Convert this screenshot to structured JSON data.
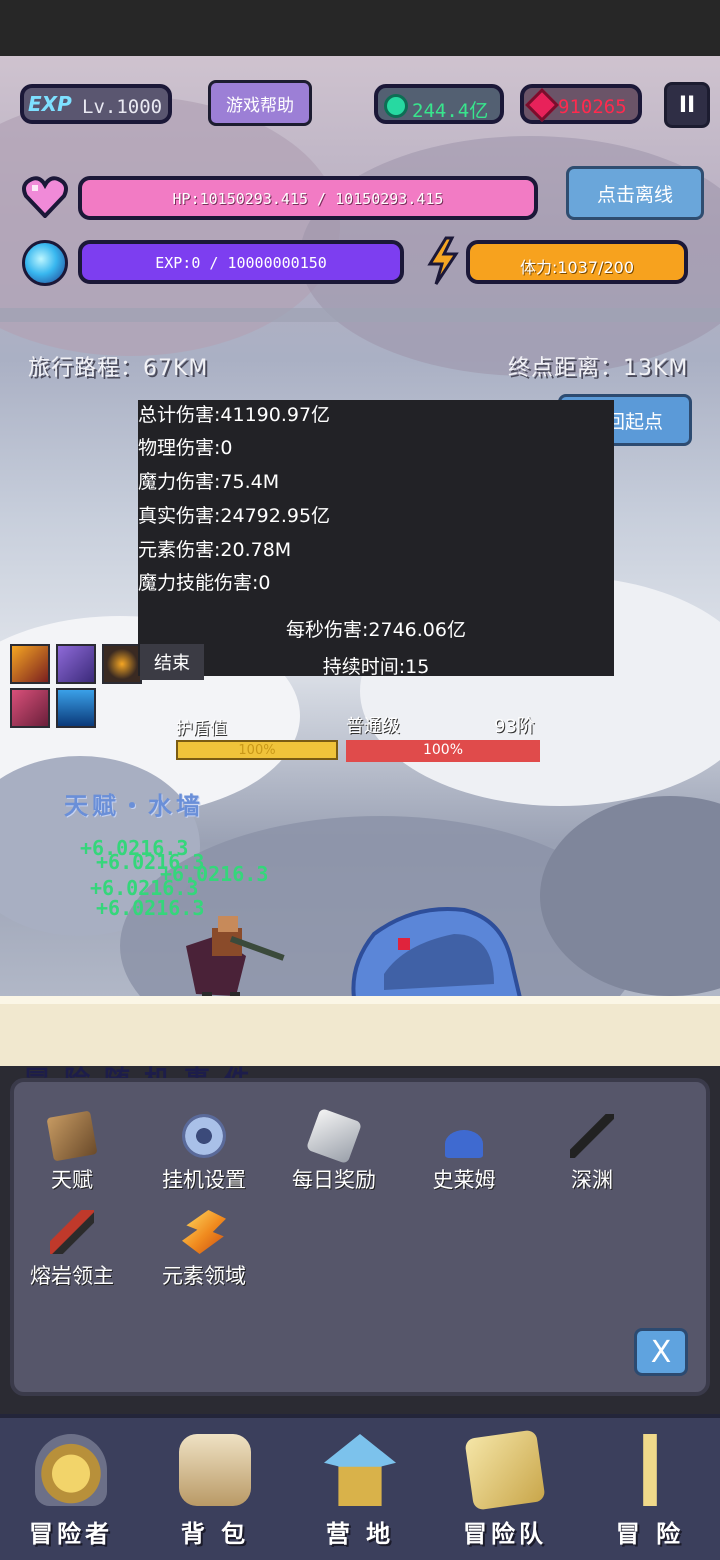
{
  "header": {
    "exp_tag": "EXP",
    "level": "Lv.1000",
    "help_label": "游戏帮助",
    "coins": "244.4亿",
    "gems": "910265",
    "pause_label": "II",
    "offline_label": "点击离线"
  },
  "stats": {
    "hp_text": "HP:10150293.415 / 10150293.415",
    "exp_text": "EXP:0 / 10000000150",
    "stamina_text": "体力:1037/200"
  },
  "journey": {
    "travel": "旅行路程：67KM",
    "remaining": "终点距离：13KM",
    "return_label": "回起点"
  },
  "damage_panel": {
    "total": "总计伤害:41190.97亿",
    "physical": "物理伤害:0",
    "magic": "魔力伤害:75.4M",
    "true_dmg": "真实伤害:24792.95亿",
    "element": "元素伤害:20.78M",
    "magic_skill": "魔力技能伤害:0",
    "dps": "每秒伤害:2746.06亿",
    "duration": "持续时间:15",
    "end_label": "结束"
  },
  "battle": {
    "shield_label": "护盾值",
    "shield_pct": "100%",
    "rank_label": "普通级",
    "tier_label": "93阶",
    "boss_hp_pct": "100%",
    "talent_text": "天赋・水墙",
    "heal_numbers": [
      "+6.0216.3",
      "+6.0216.3",
      "+6.0216.3",
      "+6.0216.3",
      "+6.0216.3"
    ]
  },
  "menu": {
    "header": "冒险随机事件",
    "items": [
      {
        "label": "天赋",
        "icon": "book-icon"
      },
      {
        "label": "挂机设置",
        "icon": "gear-icon"
      },
      {
        "label": "每日奖励",
        "icon": "scroll-icon"
      },
      {
        "label": "史莱姆",
        "icon": "slime-icon"
      },
      {
        "label": "深渊",
        "icon": "abyss-icon"
      },
      {
        "label": "熔岩领主",
        "icon": "sword-icon"
      },
      {
        "label": "元素领域",
        "icon": "flame-icon"
      }
    ],
    "close_label": "X"
  },
  "nav": {
    "items": [
      {
        "label": "冒险者",
        "icon": "helmet-icon"
      },
      {
        "label": "背 包",
        "icon": "backpack-icon"
      },
      {
        "label": "营 地",
        "icon": "camp-icon"
      },
      {
        "label": "冒险队",
        "icon": "team-icon"
      },
      {
        "label": "冒 险",
        "icon": "sword-icon"
      }
    ]
  },
  "colors": {
    "hp": "#f27bc4",
    "exp": "#7d3ef0",
    "stamina": "#f7a21e",
    "button_blue": "#6aa6da",
    "help_purple": "#9c7fd6"
  }
}
